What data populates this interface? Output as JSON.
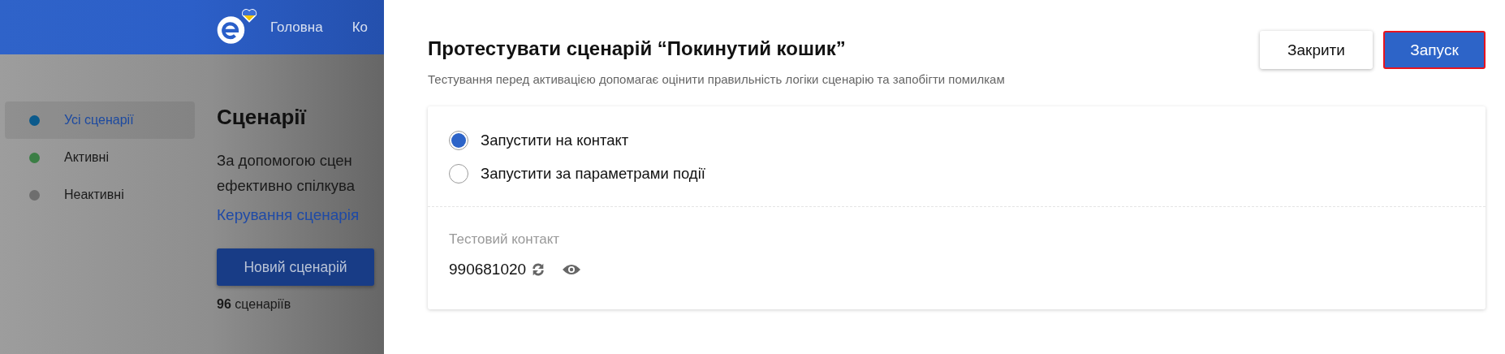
{
  "header": {
    "nav": [
      "Головна",
      "Ко"
    ]
  },
  "sidebar": {
    "items": [
      {
        "label": "Усі сценарії",
        "color": "#0b5a8c",
        "selected": true
      },
      {
        "label": "Активні",
        "color": "#3b7e45",
        "selected": false
      },
      {
        "label": "Неактивні",
        "color": "#6e6e6e",
        "selected": false
      }
    ]
  },
  "page": {
    "title": "Сценарії",
    "description_lines": [
      "За допомогою сцен",
      "ефективно спілкува"
    ],
    "link": "Керування сценарія",
    "new_button": "Новий сценарій",
    "count": "**96** сценаріїв"
  },
  "modal": {
    "title": "Протестувати сценарій “Покинутий кошик”",
    "subtitle": "Тестування перед активацією допомагає оцінити правильність логіки сценарію та запобігти помилкам",
    "buttons": [
      {
        "label": "Закрити",
        "kind": "secondary",
        "focused": false
      },
      {
        "label": "Запуск",
        "kind": "primary",
        "focused": true
      }
    ],
    "options": [
      {
        "label": "Запустити на контакт",
        "selected": true
      },
      {
        "label": "Запустити за параметрами події",
        "selected": false
      }
    ],
    "test_contact": {
      "label": "Тестовий контакт",
      "value": "990681020"
    }
  }
}
